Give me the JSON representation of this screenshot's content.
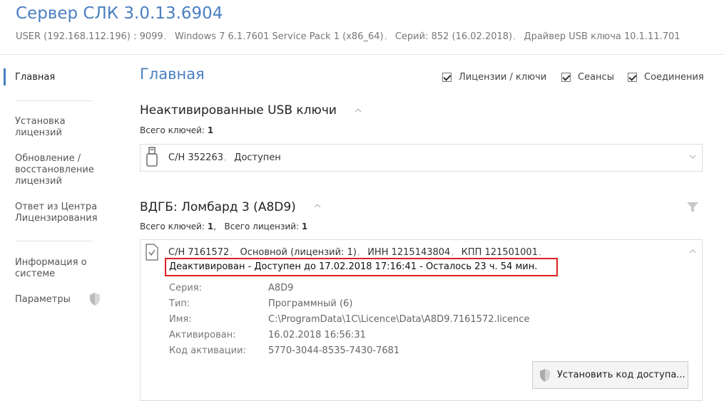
{
  "app": {
    "title": "Сервер СЛК 3.0.13.6904",
    "sysinfo": [
      "USER (192.168.112.196) : 9099",
      "Windows 7 6.1.7601 Service Pack 1 (x86_64)",
      "Серий: 852 (16.02.2018)",
      "Драйвер USB ключа 10.1.11.701"
    ]
  },
  "sidebar": {
    "items": [
      "Главная",
      "Установка лицензий",
      "Обновление / восстановление лицензий",
      "Ответ из Центра Лицензирования",
      "Информация о системе",
      "Параметры"
    ]
  },
  "main": {
    "title": "Главная",
    "filters": [
      {
        "label": "Лицензии / ключи",
        "checked": true
      },
      {
        "label": "Сеансы",
        "checked": true
      },
      {
        "label": "Соединения",
        "checked": true
      }
    ]
  },
  "usb_section": {
    "title": "Неактивированные USB ключи",
    "total_label": "Всего ключей:",
    "total_value": "1",
    "key": {
      "serial": "С/Н 352263",
      "status": "Доступен"
    }
  },
  "vdgb_section": {
    "title": "ВДГБ: Ломбард 3 (A8D9)",
    "total_keys_label": "Всего ключей:",
    "total_keys_value": "1",
    "total_licenses_label": "Всего лицензий:",
    "total_licenses_value": "1",
    "license": {
      "serial": "С/Н 7161572",
      "kind": "Основной (лицензий: 1)",
      "inn": "ИНН 1215143804",
      "kpp": "КПП 121501001",
      "status": "Деактивирован - Доступен до 17.02.2018 17:16:41 - Осталось 23 ч. 54 мин.",
      "details": [
        {
          "label": "Серия:",
          "value": "A8D9"
        },
        {
          "label": "Тип:",
          "value": "Программный (6)"
        },
        {
          "label": "Имя:",
          "value": "C:\\ProgramData\\1C\\Licence\\Data\\A8D9.7161572.licence"
        },
        {
          "label": "Активирован:",
          "value": "16.02.2018 16:56:31"
        },
        {
          "label": "Код активации:",
          "value": "5770-3044-8535-7430-7681"
        }
      ],
      "access_button": "Установить код доступа..."
    }
  },
  "icons": {
    "usb": "usb-key-icon",
    "license": "license-file-icon",
    "shield": "shield-icon",
    "filter": "filter-icon",
    "chevron_up": "chevron-up-icon",
    "chevron_down": "chevron-down-icon"
  },
  "colors": {
    "accent": "#4a7fc1",
    "highlight": "#e02020"
  }
}
